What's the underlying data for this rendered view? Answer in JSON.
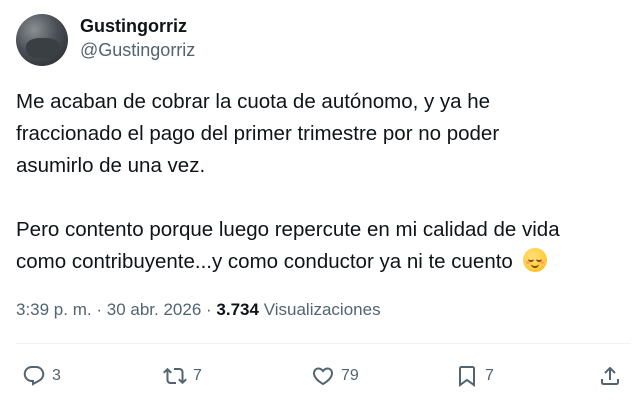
{
  "author": {
    "display_name": "Gustingorriz",
    "handle": "@Gustingorriz"
  },
  "tweet": {
    "text": "Me acaban de cobrar la cuota de autónomo, y ya he\nfraccionado el pago del primer trimestre por no poder\nasumirlo de una vez.\n\nPero contento porque luego repercute en mi calidad de vida\ncomo contribuyente...y como conductor ya ni te cuento",
    "emoji": "relieved-face-icon",
    "time": "3:39 p. m.",
    "separator": "·",
    "date": "30 abr. 2026",
    "views_count": "3.734",
    "views_label": "Visualizaciones"
  },
  "actions": {
    "replies": "3",
    "reposts": "7",
    "likes": "79",
    "bookmarks": "7"
  },
  "colors": {
    "text": "#0f1419",
    "secondary": "#536471",
    "divider": "#eff3f4"
  }
}
